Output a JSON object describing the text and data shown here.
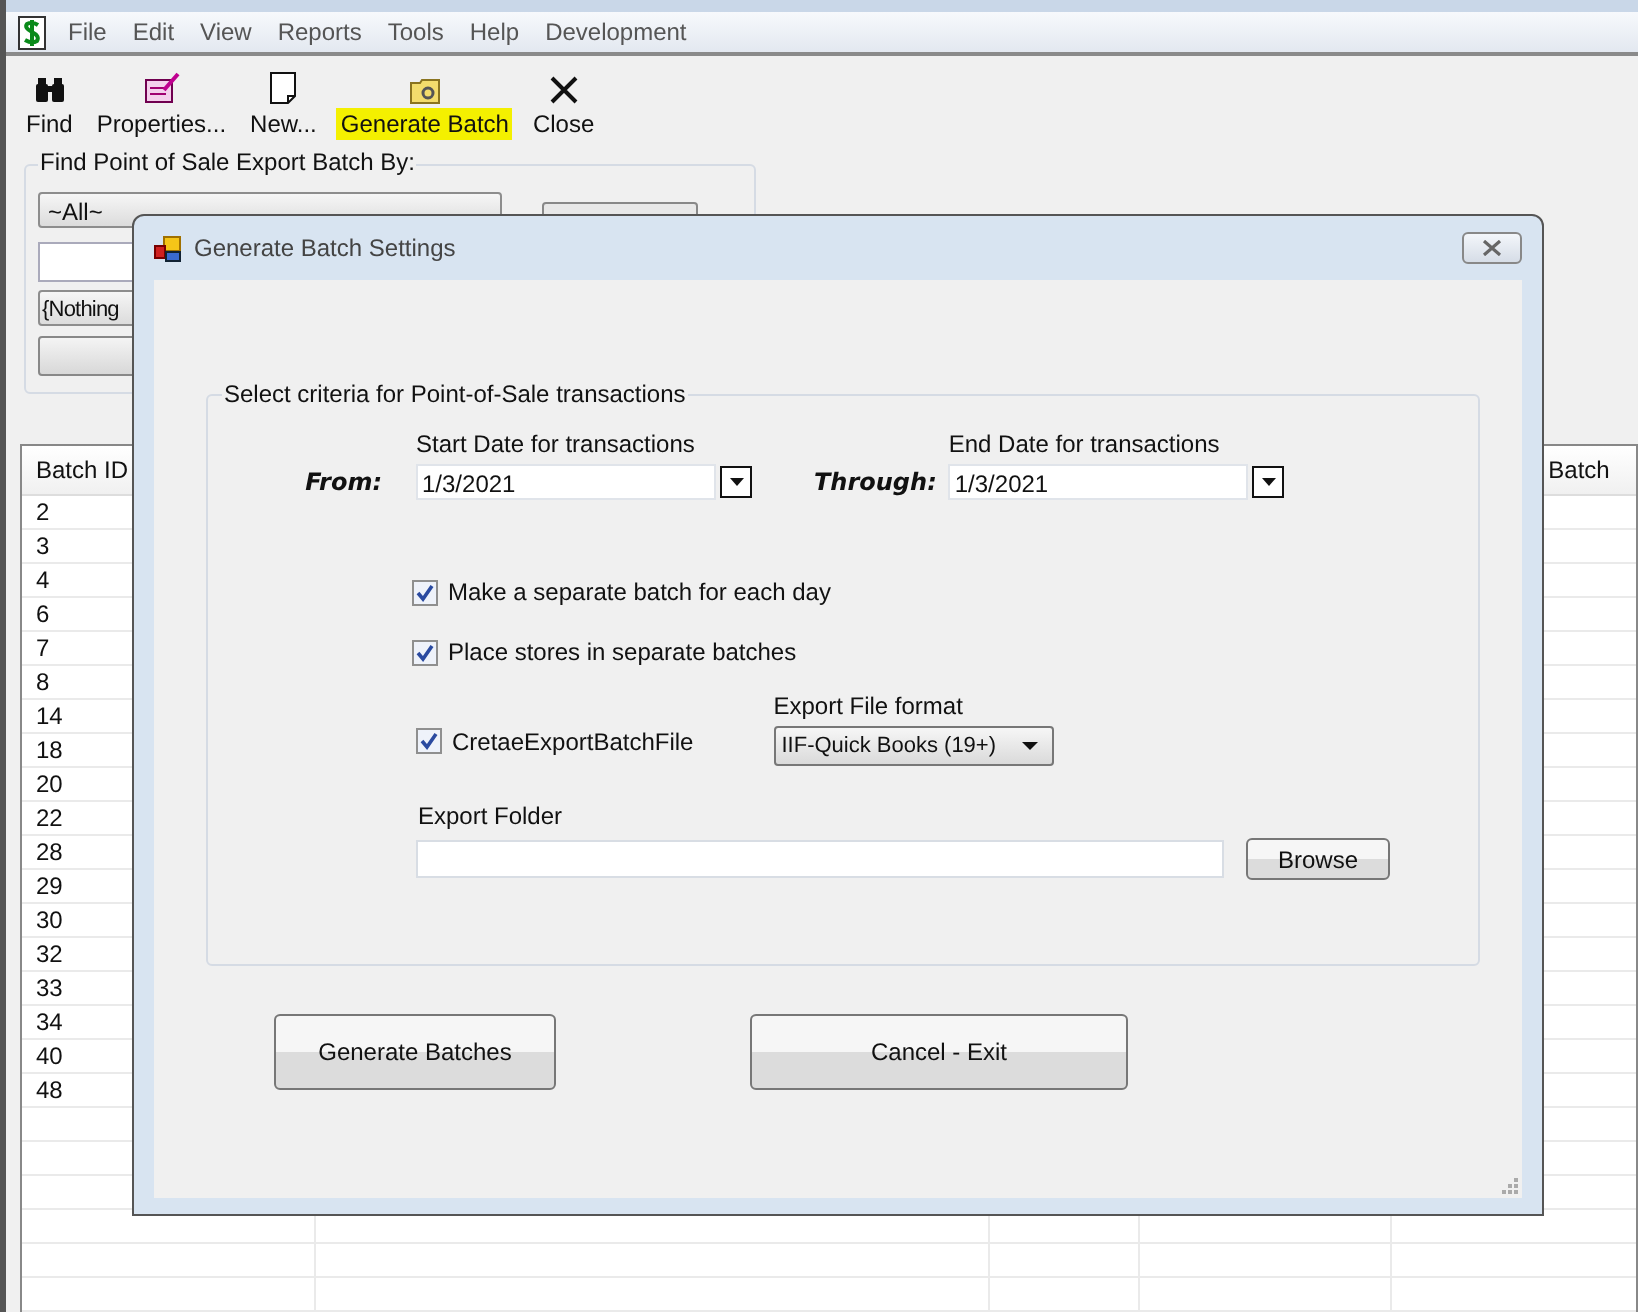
{
  "menu": [
    "File",
    "Edit",
    "View",
    "Reports",
    "Tools",
    "Help",
    "Development"
  ],
  "toolbar": [
    {
      "label": "Find",
      "kind": "find",
      "highlighted": false
    },
    {
      "label": "Properties...",
      "kind": "properties",
      "highlighted": false
    },
    {
      "label": "New...",
      "kind": "new",
      "highlighted": false
    },
    {
      "label": "Generate Batch",
      "kind": "generate",
      "highlighted": true
    },
    {
      "label": "Close",
      "kind": "close",
      "highlighted": false
    }
  ],
  "filter": {
    "title": "Find Point of Sale Export Batch By:",
    "field_dropdown": "~All~",
    "condition_dropdown": "{Nothing"
  },
  "grid": {
    "first_column": "Batch ID",
    "last_column": "Batch",
    "rows": [
      "2",
      "3",
      "4",
      "6",
      "7",
      "8",
      "14",
      "18",
      "20",
      "22",
      "28",
      "29",
      "30",
      "32",
      "33",
      "34",
      "40",
      "48"
    ]
  },
  "dialog": {
    "title": "Generate Batch Settings",
    "group_title": "Select criteria for Point-of-Sale transactions",
    "from_label": "From:",
    "start_label": "Start Date for transactions",
    "start_date": "1/3/2021",
    "through_label": "Through:",
    "end_label": "End Date for transactions",
    "end_date": "1/3/2021",
    "options": [
      {
        "label": "Make a separate batch for each day",
        "checked": true
      },
      {
        "label": "Place stores in separate batches",
        "checked": true
      },
      {
        "label": "CretaeExportBatchFile",
        "checked": true
      }
    ],
    "format_label": "Export File format",
    "format": "IIF-Quick Books (19+)",
    "folder_label": "Export Folder",
    "browse": "Browse",
    "buttons": [
      "Generate Batches",
      "Cancel - Exit"
    ]
  }
}
